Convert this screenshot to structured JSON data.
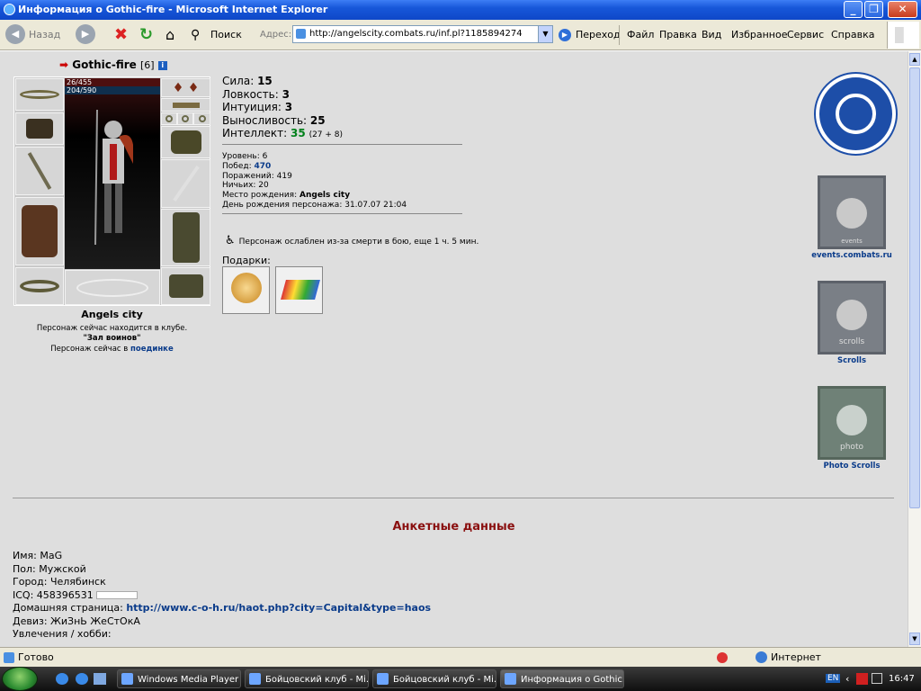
{
  "window": {
    "title": "Информация о Gothic-fire - Microsoft Internet Explorer"
  },
  "toolbar": {
    "back": "Назад",
    "search": "Поиск",
    "address_label": "Адрес:",
    "url": "http://angelscity.combats.ru/inf.pl?1185894274",
    "go": "Переход",
    "menu": [
      "Файл",
      "Правка",
      "Вид",
      "Избранное",
      "Сервис",
      "Справка"
    ]
  },
  "character": {
    "name": "Gothic-fire",
    "level": "[6]",
    "hp": "26/455",
    "mp": "204/590",
    "stats": {
      "strength_label": "Сила:",
      "strength": "15",
      "agility_label": "Ловкость:",
      "agility": "3",
      "intuition_label": "Интуиция:",
      "intuition": "3",
      "endurance_label": "Выносливость:",
      "endurance": "25",
      "intellect_label": "Интеллект:",
      "intellect": "35",
      "intellect_extra": "(27 + 8)"
    },
    "details": {
      "level_line": "Уровень: 6",
      "wins_label": "Побед:",
      "wins": "470",
      "losses": "Поражений: 419",
      "draws": "Ничьих: 20",
      "birthplace_label": "Место рождения:",
      "birthplace": "Angels city",
      "birthday": "День рождения персонажа: 31.07.07 21:04"
    },
    "weakened": "Персонаж ослаблен из-за смерти в бою, еще 1 ч. 5 мин.",
    "gifts_label": "Подарки:",
    "city": "Angels city",
    "club_line": "Персонаж сейчас находится в клубе.",
    "room": "\"Зал воинов\"",
    "duel_prefix": "Персонаж сейчас в",
    "duel_link": "поединке"
  },
  "sidebar": {
    "events": "events.combats.ru",
    "events_banner": "events",
    "scrolls": "Scrolls",
    "scrolls_banner": "scrolls",
    "photo": "Photo Scrolls",
    "photo_banner": "photo"
  },
  "anket": {
    "title": "Анкетные данные",
    "name": "Имя: MaG",
    "sex": "Пол: Мужской",
    "city": "Город: Челябинск",
    "icq": "ICQ: 458396531",
    "homepage_label": "Домашняя страница:",
    "homepage": "http://www.c-o-h.ru/haot.php?city=Capital&type=haos",
    "motto": "Девиз: ЖиЗнЬ ЖеСтОкА",
    "hobbies": "Увлечения / хобби:"
  },
  "statusbar": {
    "left": "Готово",
    "zone": "Интернет"
  },
  "taskbar": {
    "items": [
      "Windows Media Player",
      "Бойцовский клуб - Mi...",
      "Бойцовский клуб - Mi...",
      "Информация о Gothic..."
    ],
    "lang": "EN",
    "clock": "16:47"
  }
}
